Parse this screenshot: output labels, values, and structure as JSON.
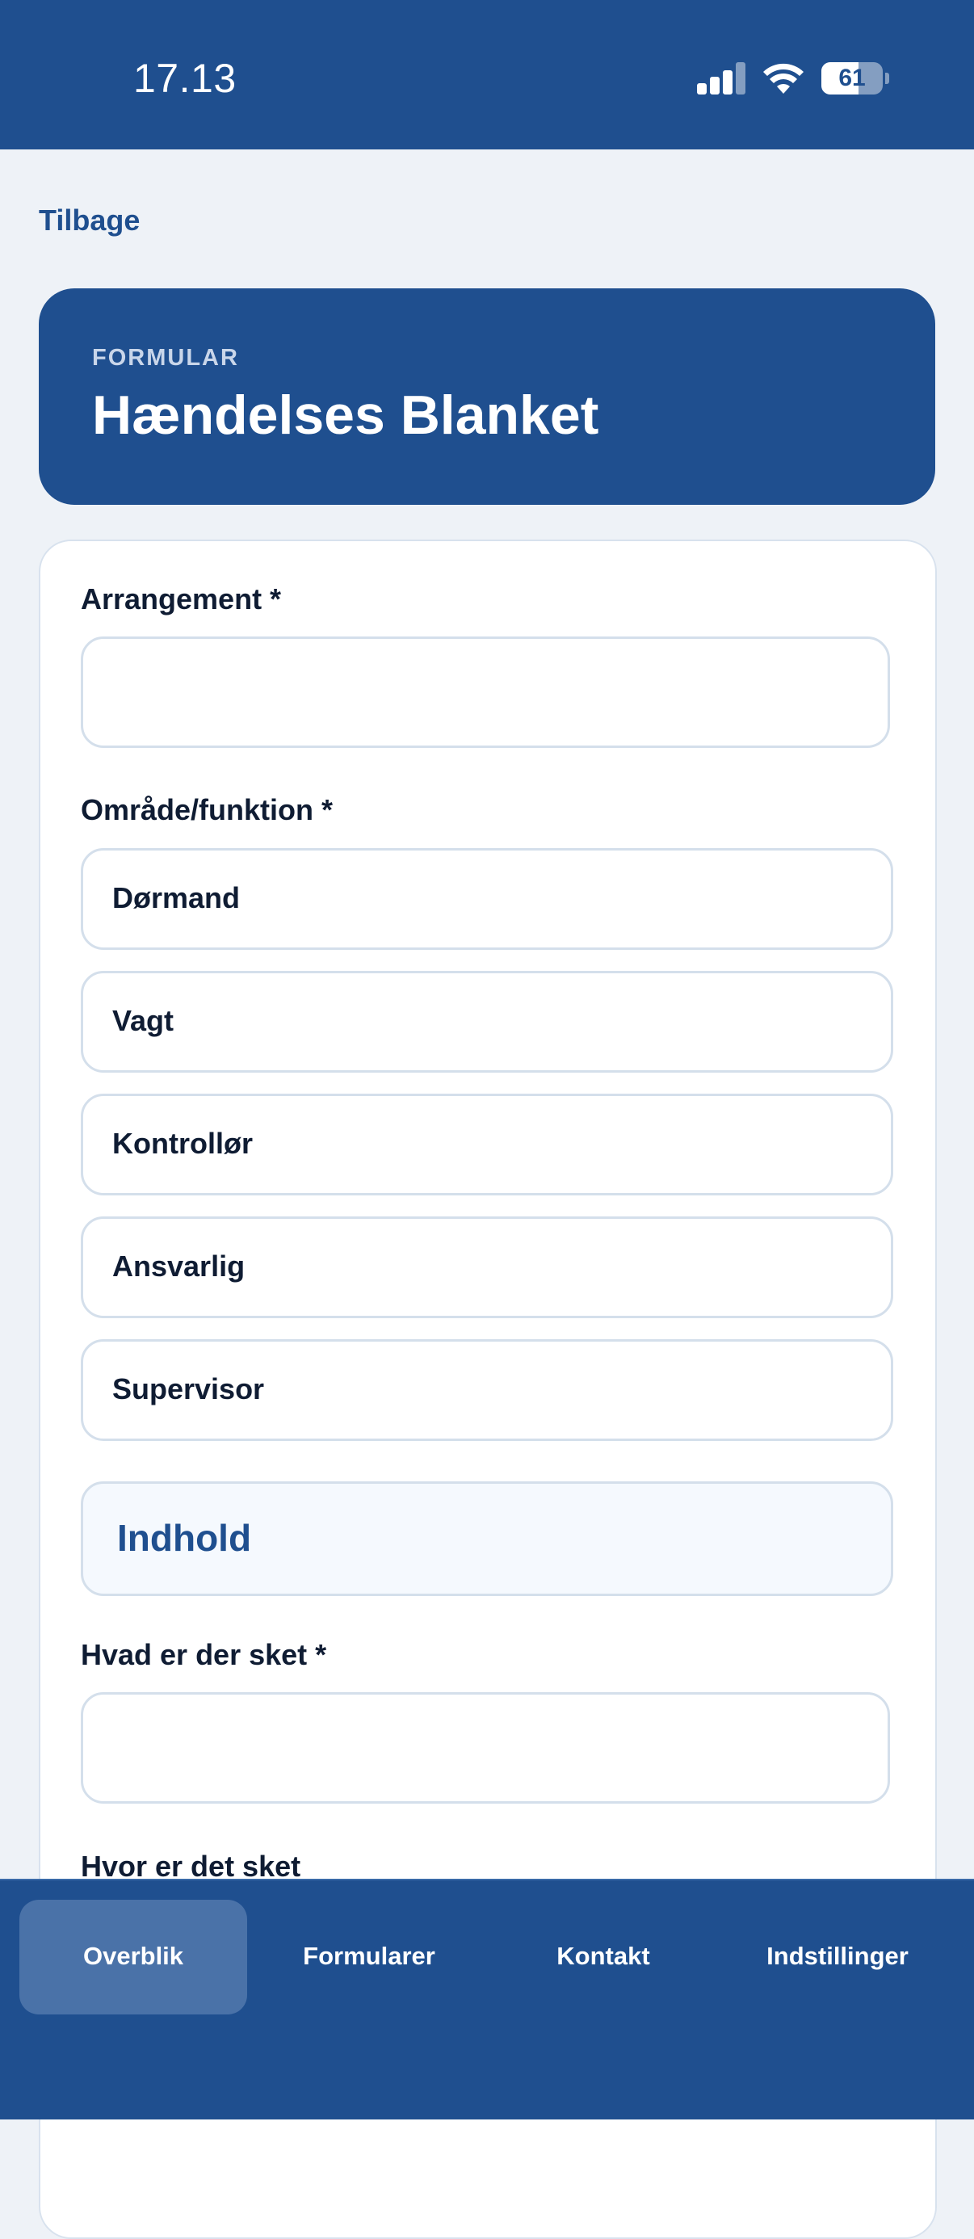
{
  "status_bar": {
    "time": "17.13",
    "battery_percent": "61",
    "battery_level": 0.61,
    "icons": [
      "signal-icon",
      "wifi-icon",
      "battery-icon"
    ]
  },
  "nav": {
    "back_label": "Tilbage"
  },
  "header": {
    "eyebrow": "FORMULAR",
    "title": "Hændelses Blanket"
  },
  "form": {
    "arrangement_label": "Arrangement *",
    "arrangement_value": "",
    "omraade_label": "Område/funktion *",
    "options": [
      "Dørmand",
      "Vagt",
      "Kontrollør",
      "Ansvarlig",
      "Supervisor"
    ],
    "section_title": "Indhold",
    "hvad_label": "Hvad er der sket *",
    "hvad_value": "",
    "hvor_label": "Hvor er det sket"
  },
  "tabs": [
    {
      "label": "Overblik",
      "active": true
    },
    {
      "label": "Formularer",
      "active": false
    },
    {
      "label": "Kontakt",
      "active": false
    },
    {
      "label": "Indstillinger",
      "active": false
    }
  ],
  "colors": {
    "brand": "#1f4f8f",
    "background": "#eef2f7",
    "text": "#0f1c33",
    "border": "#d4dfeb",
    "active_tab": "#4a72a8"
  }
}
